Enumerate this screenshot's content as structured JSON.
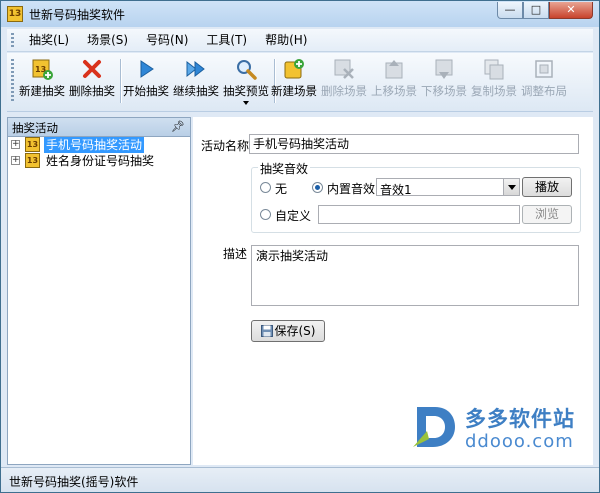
{
  "window": {
    "title": "世新号码抽奖软件",
    "controls": {
      "minimize": "—",
      "maximize": "□",
      "close": "✕"
    }
  },
  "menu": {
    "items": [
      "抽奖(L)",
      "场景(S)",
      "号码(N)",
      "工具(T)",
      "帮助(H)"
    ]
  },
  "toolbar": {
    "buttons": [
      {
        "label": "新建抽奖",
        "icon": "new-lottery-icon",
        "enabled": true
      },
      {
        "label": "删除抽奖",
        "icon": "delete-icon",
        "enabled": true
      },
      {
        "label": "开始抽奖",
        "icon": "play-icon",
        "enabled": true
      },
      {
        "label": "继续抽奖",
        "icon": "continue-icon",
        "enabled": true
      },
      {
        "label": "抽奖预览",
        "icon": "magnifier-icon",
        "enabled": true
      },
      {
        "label": "新建场景",
        "icon": "new-scene-icon",
        "enabled": true
      },
      {
        "label": "删除场景",
        "icon": "delete-scene-icon",
        "enabled": false
      },
      {
        "label": "上移场景",
        "icon": "move-up-icon",
        "enabled": false
      },
      {
        "label": "下移场景",
        "icon": "move-down-icon",
        "enabled": false
      },
      {
        "label": "复制场景",
        "icon": "copy-scene-icon",
        "enabled": false
      },
      {
        "label": "调整布局",
        "icon": "layout-icon",
        "enabled": false
      }
    ]
  },
  "left_panel": {
    "title": "抽奖活动",
    "pin": "ꟷ",
    "tree": [
      {
        "label": "手机号码抽奖活动",
        "expander": "+",
        "icon_text": "13",
        "selected": true
      },
      {
        "label": "姓名身份证号码抽奖",
        "expander": "+",
        "icon_text": "13",
        "selected": false
      }
    ]
  },
  "form": {
    "activity_name_label": "活动名称",
    "activity_name_value": "手机号码抽奖活动",
    "sound_group_title": "抽奖音效",
    "radio_none_label": "无",
    "radio_builtin_label": "内置音效",
    "radio_custom_label": "自定义",
    "selected_radio": "内置音效",
    "sound_select_value": "音效1",
    "play_button": "播放",
    "custom_path_value": "",
    "browse_button": "浏览",
    "description_label": "描述",
    "description_value": "演示抽奖活动",
    "save_button": "保存(S)"
  },
  "statusbar": {
    "text": "世新号码抽奖(摇号)软件"
  },
  "watermark": {
    "name": "多多软件站",
    "url": "ddooo.com"
  },
  "colors": {
    "selection": "#3399ff",
    "titlebar": "#b8d3ef",
    "accent_red": "#d9321c"
  }
}
